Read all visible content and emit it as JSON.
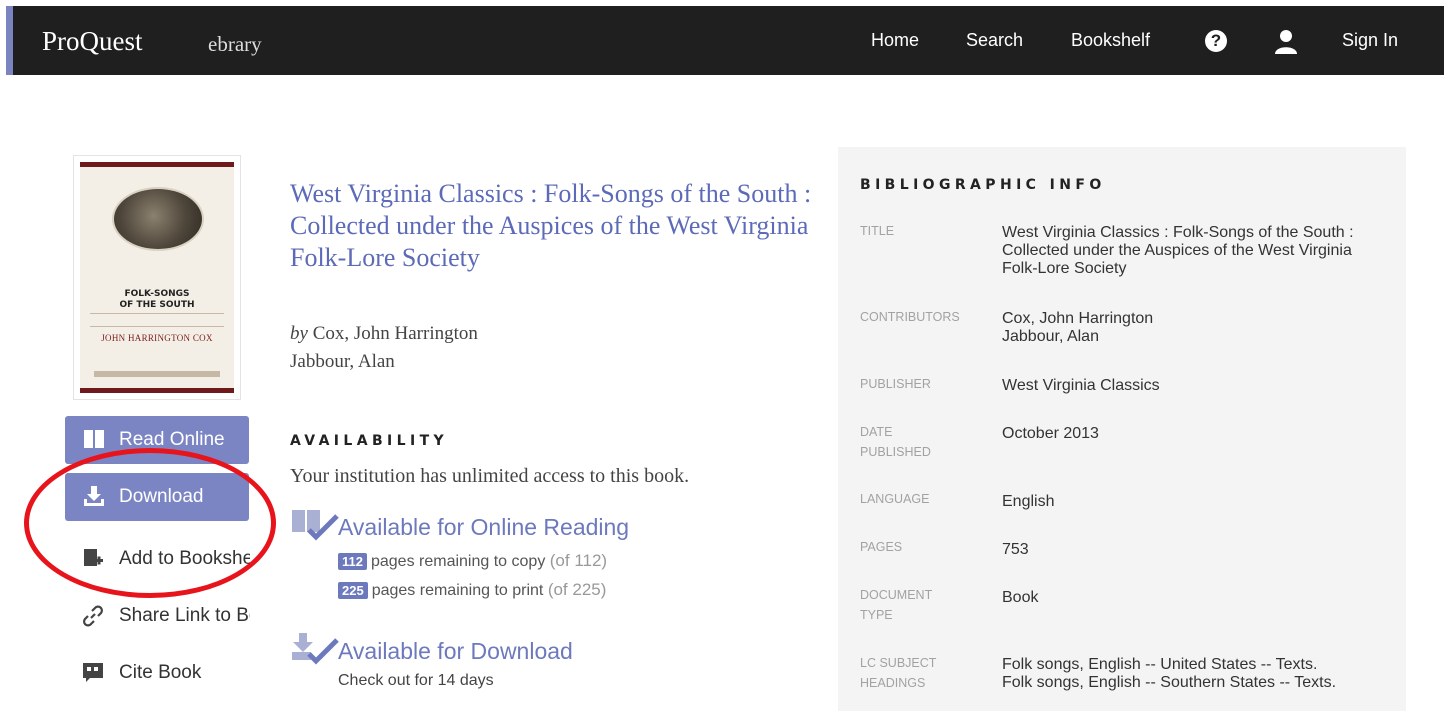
{
  "header": {
    "brand": "ProQuest",
    "brand_sub": "ebrary",
    "nav": [
      "Home",
      "Search",
      "Bookshelf"
    ],
    "help_icon": "help-icon",
    "user_icon": "user-icon",
    "sign_in": "Sign In",
    "accent_color": "#7a84c0"
  },
  "cover": {
    "title_line1": "FOLK-SONGS",
    "title_line2": "OF THE SOUTH",
    "author": "JOHN HARRINGTON COX"
  },
  "actions": {
    "read_online": "Read Online",
    "download": "Download",
    "add_to_bookshelf": "Add to Bookshelf",
    "share_link": "Share Link to Book",
    "cite_book": "Cite Book",
    "button_color": "#7b85c4"
  },
  "book": {
    "title": "West Virginia Classics : Folk-Songs of the South : Collected under the Auspices of the West Virginia Folk-Lore Society",
    "by_label": "by",
    "authors": [
      "Cox, John Harrington",
      "Jabbour, Alan"
    ]
  },
  "availability": {
    "heading": "AVAILABILITY",
    "statement": "Your institution has unlimited access to this book.",
    "online_label": "Available for Online Reading",
    "copy_count": "112",
    "copy_text": "pages remaining to copy",
    "copy_of": "(of 112)",
    "print_count": "225",
    "print_text": "pages remaining to print",
    "print_of": "(of 225)",
    "download_label": "Available for Download",
    "checkout_text": "Check out for 14 days"
  },
  "biblio": {
    "heading": "BIBLIOGRAPHIC INFO",
    "rows": [
      {
        "key": "TITLE",
        "value": "West Virginia Classics : Folk-Songs of the South : Collected under the Auspices of the West Virginia Folk-Lore Society"
      },
      {
        "key": "CONTRIBUTORS",
        "value": "Cox, John Harrington\nJabbour, Alan"
      },
      {
        "key": "PUBLISHER",
        "value": "West Virginia Classics"
      },
      {
        "key": "DATE PUBLISHED",
        "value": "October 2013"
      },
      {
        "key": "LANGUAGE",
        "value": "English"
      },
      {
        "key": "PAGES",
        "value": "753"
      },
      {
        "key": "DOCUMENT TYPE",
        "value": "Book"
      },
      {
        "key": "LC SUBJECT HEADINGS",
        "value": "Folk songs, English -- United States -- Texts.\nFolk songs, English -- Southern States -- Texts."
      }
    ]
  }
}
